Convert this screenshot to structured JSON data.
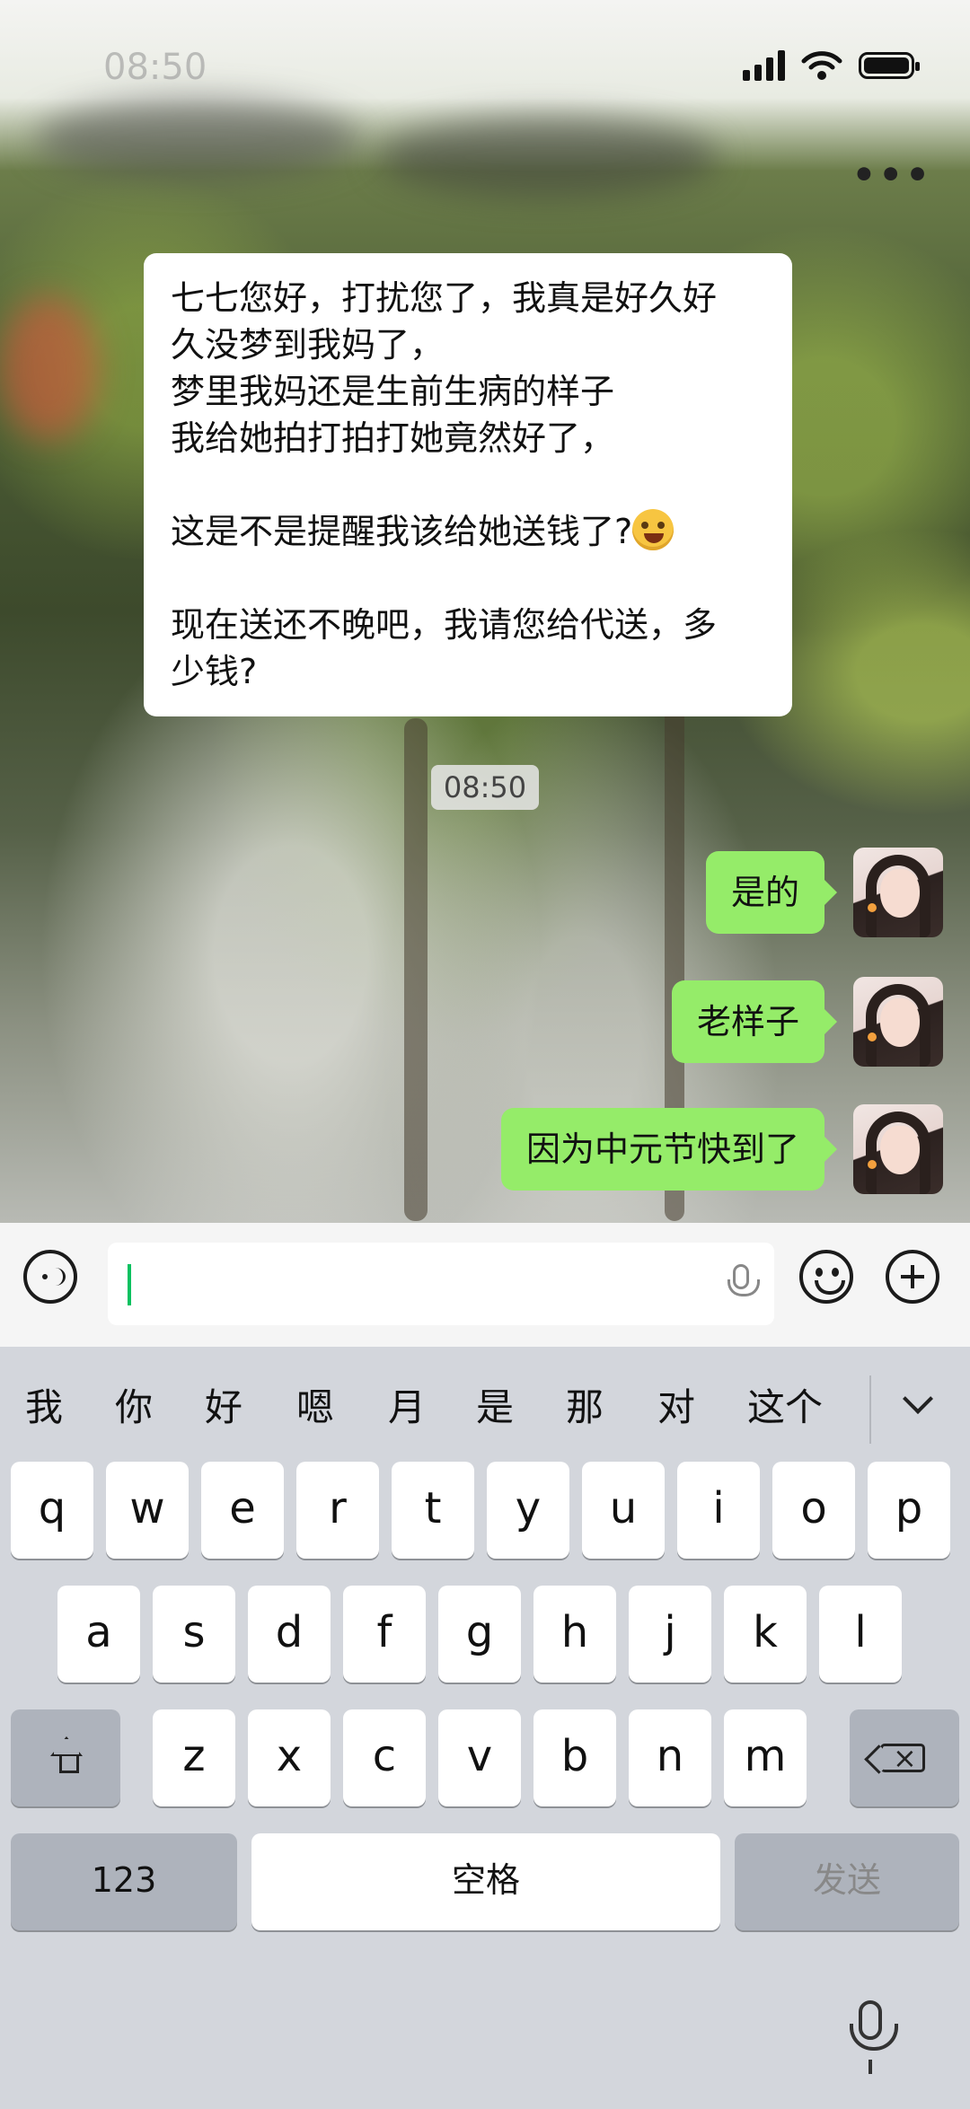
{
  "status_bar": {
    "time": "08:50"
  },
  "chat": {
    "incoming_message": {
      "lines": [
        "七七您好，打扰您了，我真是好久好",
        "久没梦到我妈了，",
        "梦里我妈还是生前生病的样子",
        "我给她拍打拍打她竟然好了，",
        "",
        "这是不是提醒我该给她送钱了?",
        "",
        "现在送还不晚吧，我请您给代送，多",
        "少钱?"
      ]
    },
    "timestamp": "08:50",
    "outgoing_messages": [
      "是的",
      "老样子",
      "因为中元节快到了"
    ]
  },
  "input_bar": {
    "value": ""
  },
  "keyboard": {
    "candidates": [
      "我",
      "你",
      "好",
      "嗯",
      "月",
      "是",
      "那",
      "对",
      "这个"
    ],
    "row1": [
      "q",
      "w",
      "e",
      "r",
      "t",
      "y",
      "u",
      "i",
      "o",
      "p"
    ],
    "row2": [
      "a",
      "s",
      "d",
      "f",
      "g",
      "h",
      "j",
      "k",
      "l"
    ],
    "row3": [
      "z",
      "x",
      "c",
      "v",
      "b",
      "n",
      "m"
    ],
    "num_label": "123",
    "space_label": "空格",
    "send_label": "发送"
  },
  "icons": {
    "more": "more-icon",
    "voice": "voice-icon",
    "emoji": "emoji-icon",
    "plus": "plus-icon",
    "microphone": "mic-icon"
  },
  "colors": {
    "outgoing_bubble": "#95ec69",
    "caret": "#07c160"
  }
}
